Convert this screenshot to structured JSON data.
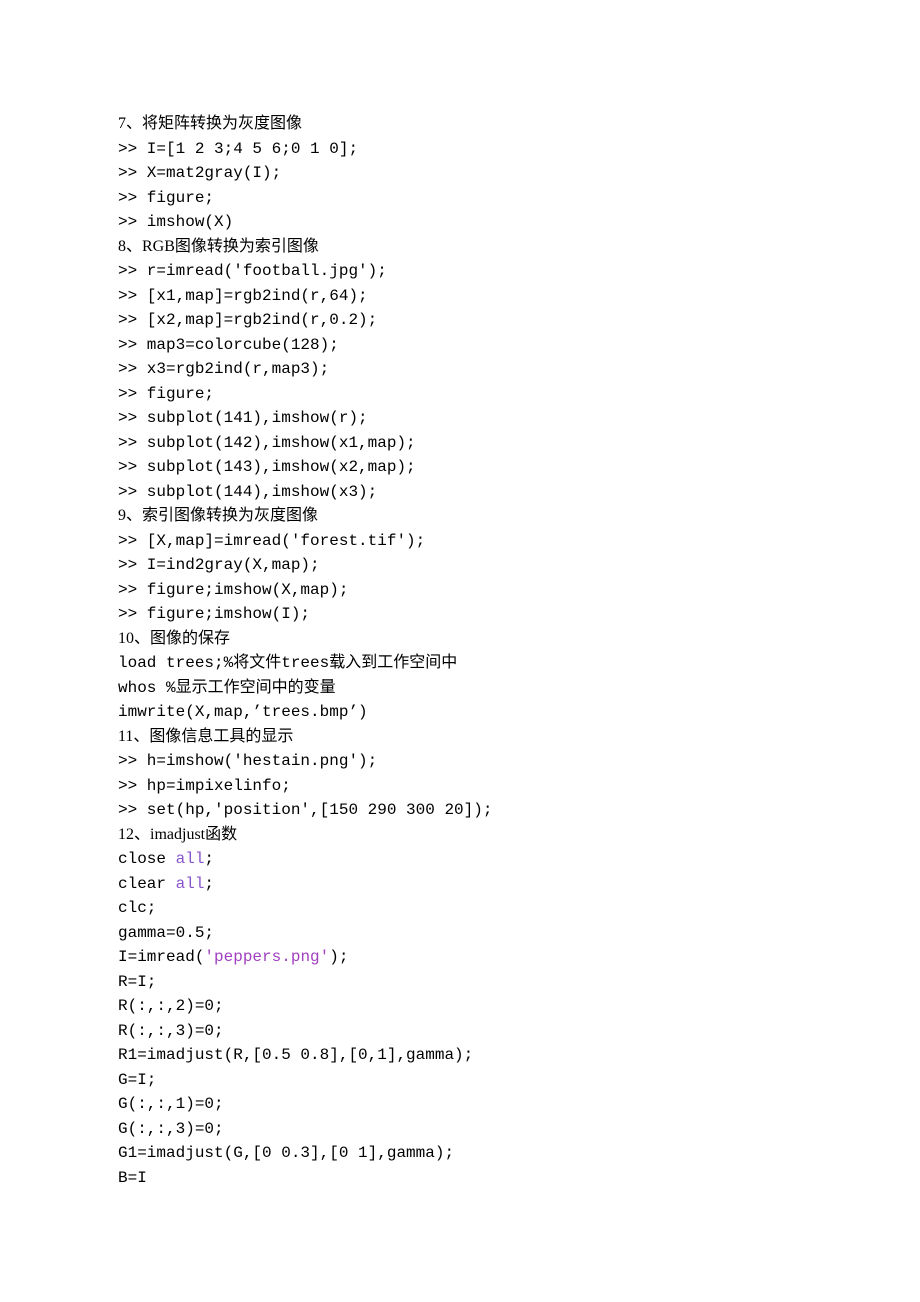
{
  "lines": [
    {
      "cls": "hdr",
      "segs": [
        {
          "t": "7、将矩阵转换为灰度图像"
        }
      ]
    },
    {
      "segs": [
        {
          "t": ">> I=[1 2 3;4 5 6;0 1 0];"
        }
      ]
    },
    {
      "segs": [
        {
          "t": ">> X=mat2gray(I);"
        }
      ]
    },
    {
      "segs": [
        {
          "t": ">> figure;"
        }
      ]
    },
    {
      "segs": [
        {
          "t": ">> imshow(X)"
        }
      ]
    },
    {
      "cls": "hdr",
      "segs": [
        {
          "t": "8、RGB图像转换为索引图像"
        }
      ]
    },
    {
      "segs": [
        {
          "t": ">> r=imread('football.jpg');"
        }
      ]
    },
    {
      "segs": [
        {
          "t": ">> [x1,map]=rgb2ind(r,64);"
        }
      ]
    },
    {
      "segs": [
        {
          "t": ">> [x2,map]=rgb2ind(r,0.2);"
        }
      ]
    },
    {
      "segs": [
        {
          "t": ">> map3=colorcube(128);"
        }
      ]
    },
    {
      "segs": [
        {
          "t": ">> x3=rgb2ind(r,map3);"
        }
      ]
    },
    {
      "segs": [
        {
          "t": ">> figure;"
        }
      ]
    },
    {
      "segs": [
        {
          "t": ">> subplot(141),imshow(r);"
        }
      ]
    },
    {
      "segs": [
        {
          "t": ">> subplot(142),imshow(x1,map);"
        }
      ]
    },
    {
      "segs": [
        {
          "t": ">> subplot(143),imshow(x2,map);"
        }
      ]
    },
    {
      "segs": [
        {
          "t": ">> subplot(144),imshow(x3);"
        }
      ]
    },
    {
      "cls": "hdr",
      "segs": [
        {
          "t": "9、索引图像转换为灰度图像"
        }
      ]
    },
    {
      "segs": [
        {
          "t": ">> [X,map]=imread('forest.tif');"
        }
      ]
    },
    {
      "segs": [
        {
          "t": ">> I=ind2gray(X,map);"
        }
      ]
    },
    {
      "segs": [
        {
          "t": ">> figure;imshow(X,map);"
        }
      ]
    },
    {
      "segs": [
        {
          "t": ">> figure;imshow(I);"
        }
      ]
    },
    {
      "cls": "hdr",
      "segs": [
        {
          "t": "10、图像的保存"
        }
      ]
    },
    {
      "segs": [
        {
          "t": "load trees;%将文件trees载入到工作空间中"
        }
      ]
    },
    {
      "segs": [
        {
          "t": "whos %显示工作空间中的变量"
        }
      ]
    },
    {
      "segs": [
        {
          "t": "imwrite(X,map,’trees.bmp’)"
        }
      ]
    },
    {
      "cls": "hdr",
      "segs": [
        {
          "t": "11、图像信息工具的显示"
        }
      ]
    },
    {
      "segs": [
        {
          "t": ">> h=imshow('hestain.png');"
        }
      ]
    },
    {
      "segs": [
        {
          "t": ">> hp=impixelinfo;"
        }
      ]
    },
    {
      "segs": [
        {
          "t": ">> set(hp,'position',[150 290 300 20]);"
        }
      ]
    },
    {
      "cls": "hdr",
      "segs": [
        {
          "t": "12、imadjust函数"
        }
      ]
    },
    {
      "segs": [
        {
          "t": "close "
        },
        {
          "t": "all",
          "c": "kw"
        },
        {
          "t": ";"
        }
      ]
    },
    {
      "segs": [
        {
          "t": "clear "
        },
        {
          "t": "all",
          "c": "kw"
        },
        {
          "t": ";"
        }
      ]
    },
    {
      "segs": [
        {
          "t": "clc;"
        }
      ]
    },
    {
      "segs": [
        {
          "t": "gamma=0.5;"
        }
      ]
    },
    {
      "segs": [
        {
          "t": "I=imread("
        },
        {
          "t": "'peppers.png'",
          "c": "str"
        },
        {
          "t": ");"
        }
      ]
    },
    {
      "segs": [
        {
          "t": "R=I;"
        }
      ]
    },
    {
      "segs": [
        {
          "t": "R(:,:,2)=0;"
        }
      ]
    },
    {
      "segs": [
        {
          "t": "R(:,:,3)=0;"
        }
      ]
    },
    {
      "segs": [
        {
          "t": "R1=imadjust(R,[0.5 0.8],[0,1],gamma);"
        }
      ]
    },
    {
      "segs": [
        {
          "t": "G=I;"
        }
      ]
    },
    {
      "segs": [
        {
          "t": "G(:,:,1)=0;"
        }
      ]
    },
    {
      "segs": [
        {
          "t": "G(:,:,3)=0;"
        }
      ]
    },
    {
      "segs": [
        {
          "t": "G1=imadjust(G,[0 0.3],[0 1],gamma);"
        }
      ]
    },
    {
      "segs": [
        {
          "t": "B=I"
        }
      ]
    }
  ]
}
